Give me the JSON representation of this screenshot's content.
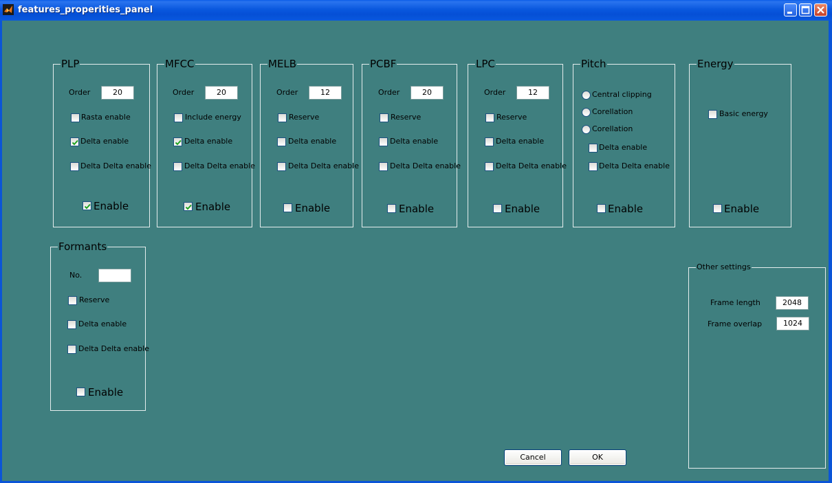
{
  "window": {
    "title": "features_properities_panel"
  },
  "colors": {
    "background": "#3f7f7f",
    "titlebar": "#0a58de",
    "check": "#21a121"
  },
  "panels": {
    "plp": {
      "title": "PLP",
      "order_label": "Order",
      "order_value": "20",
      "options": [
        {
          "label": "Rasta enable",
          "checked": false
        },
        {
          "label": "Delta enable",
          "checked": true
        },
        {
          "label": "Delta Delta enable",
          "checked": false
        }
      ],
      "enable_label": "Enable",
      "enable_checked": true
    },
    "mfcc": {
      "title": "MFCC",
      "order_label": "Order",
      "order_value": "20",
      "options": [
        {
          "label": "Include energy",
          "checked": false
        },
        {
          "label": "Delta enable",
          "checked": true
        },
        {
          "label": "Delta Delta enable",
          "checked": false
        }
      ],
      "enable_label": "Enable",
      "enable_checked": true
    },
    "melb": {
      "title": "MELB",
      "order_label": "Order",
      "order_value": "12",
      "options": [
        {
          "label": "Reserve",
          "checked": false
        },
        {
          "label": "Delta enable",
          "checked": false
        },
        {
          "label": "Delta Delta enable",
          "checked": false
        }
      ],
      "enable_label": "Enable",
      "enable_checked": false
    },
    "pcbf": {
      "title": "PCBF",
      "order_label": "Order",
      "order_value": "20",
      "options": [
        {
          "label": "Reserve",
          "checked": false
        },
        {
          "label": "Delta enable",
          "checked": false
        },
        {
          "label": "Delta Delta enable",
          "checked": false
        }
      ],
      "enable_label": "Enable",
      "enable_checked": false
    },
    "lpc": {
      "title": "LPC",
      "order_label": "Order",
      "order_value": "12",
      "options": [
        {
          "label": "Reserve",
          "checked": false
        },
        {
          "label": "Delta enable",
          "checked": false
        },
        {
          "label": "Delta Delta enable",
          "checked": false
        }
      ],
      "enable_label": "Enable",
      "enable_checked": false
    },
    "pitch": {
      "title": "Pitch",
      "radios": [
        {
          "label": "Central clipping"
        },
        {
          "label": "Corellation"
        },
        {
          "label": "Corellation"
        }
      ],
      "options": [
        {
          "label": "Delta enable",
          "checked": false
        },
        {
          "label": "Delta Delta enable",
          "checked": false
        }
      ],
      "enable_label": "Enable",
      "enable_checked": false
    },
    "energy": {
      "title": "Energy",
      "options": [
        {
          "label": "Basic energy",
          "checked": false
        }
      ],
      "enable_label": "Enable",
      "enable_checked": false
    },
    "formants": {
      "title": "Formants",
      "no_label": "No.",
      "no_value": "",
      "options": [
        {
          "label": "Reserve",
          "checked": false
        },
        {
          "label": "Delta enable",
          "checked": false
        },
        {
          "label": "Delta Delta enable",
          "checked": false
        }
      ],
      "enable_label": "Enable",
      "enable_checked": false
    }
  },
  "other_settings": {
    "title": "Other settings",
    "frame_length_label": "Frame length",
    "frame_length_value": "2048",
    "frame_overlap_label": "Frame overlap",
    "frame_overlap_value": "1024"
  },
  "buttons": {
    "cancel": "Cancel",
    "ok": "OK"
  }
}
